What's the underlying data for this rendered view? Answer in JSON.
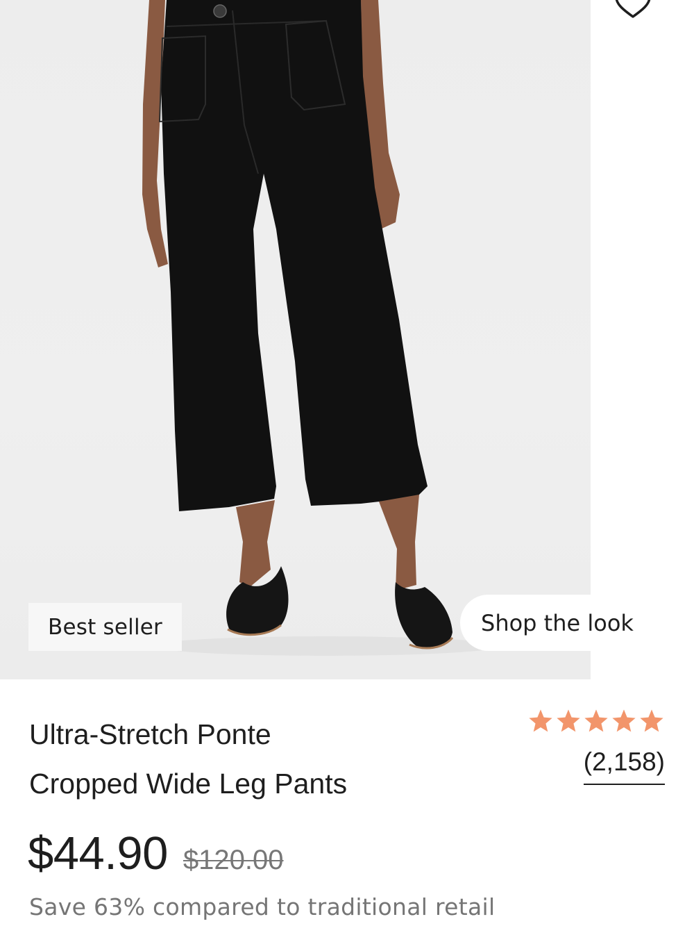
{
  "product": {
    "badge": "Best seller",
    "shop_the_look": "Shop the look",
    "title_line1": "Ultra-Stretch Ponte",
    "title_line2": "Cropped Wide Leg Pants",
    "rating": {
      "stars": 5,
      "review_count": "(2,158)",
      "star_color": "#F2956B"
    },
    "price": {
      "current": "$44.90",
      "original": "$120.00"
    },
    "savings": "Save 63% compared to traditional retail"
  },
  "icons": {
    "wishlist": "heart-outline-icon",
    "star": "star-filled-icon"
  },
  "colors": {
    "background": "#ffffff",
    "image_background": "#ededed",
    "text": "#1e1e1e",
    "muted_text": "#757575",
    "badge_background": "#f7f7f7"
  }
}
